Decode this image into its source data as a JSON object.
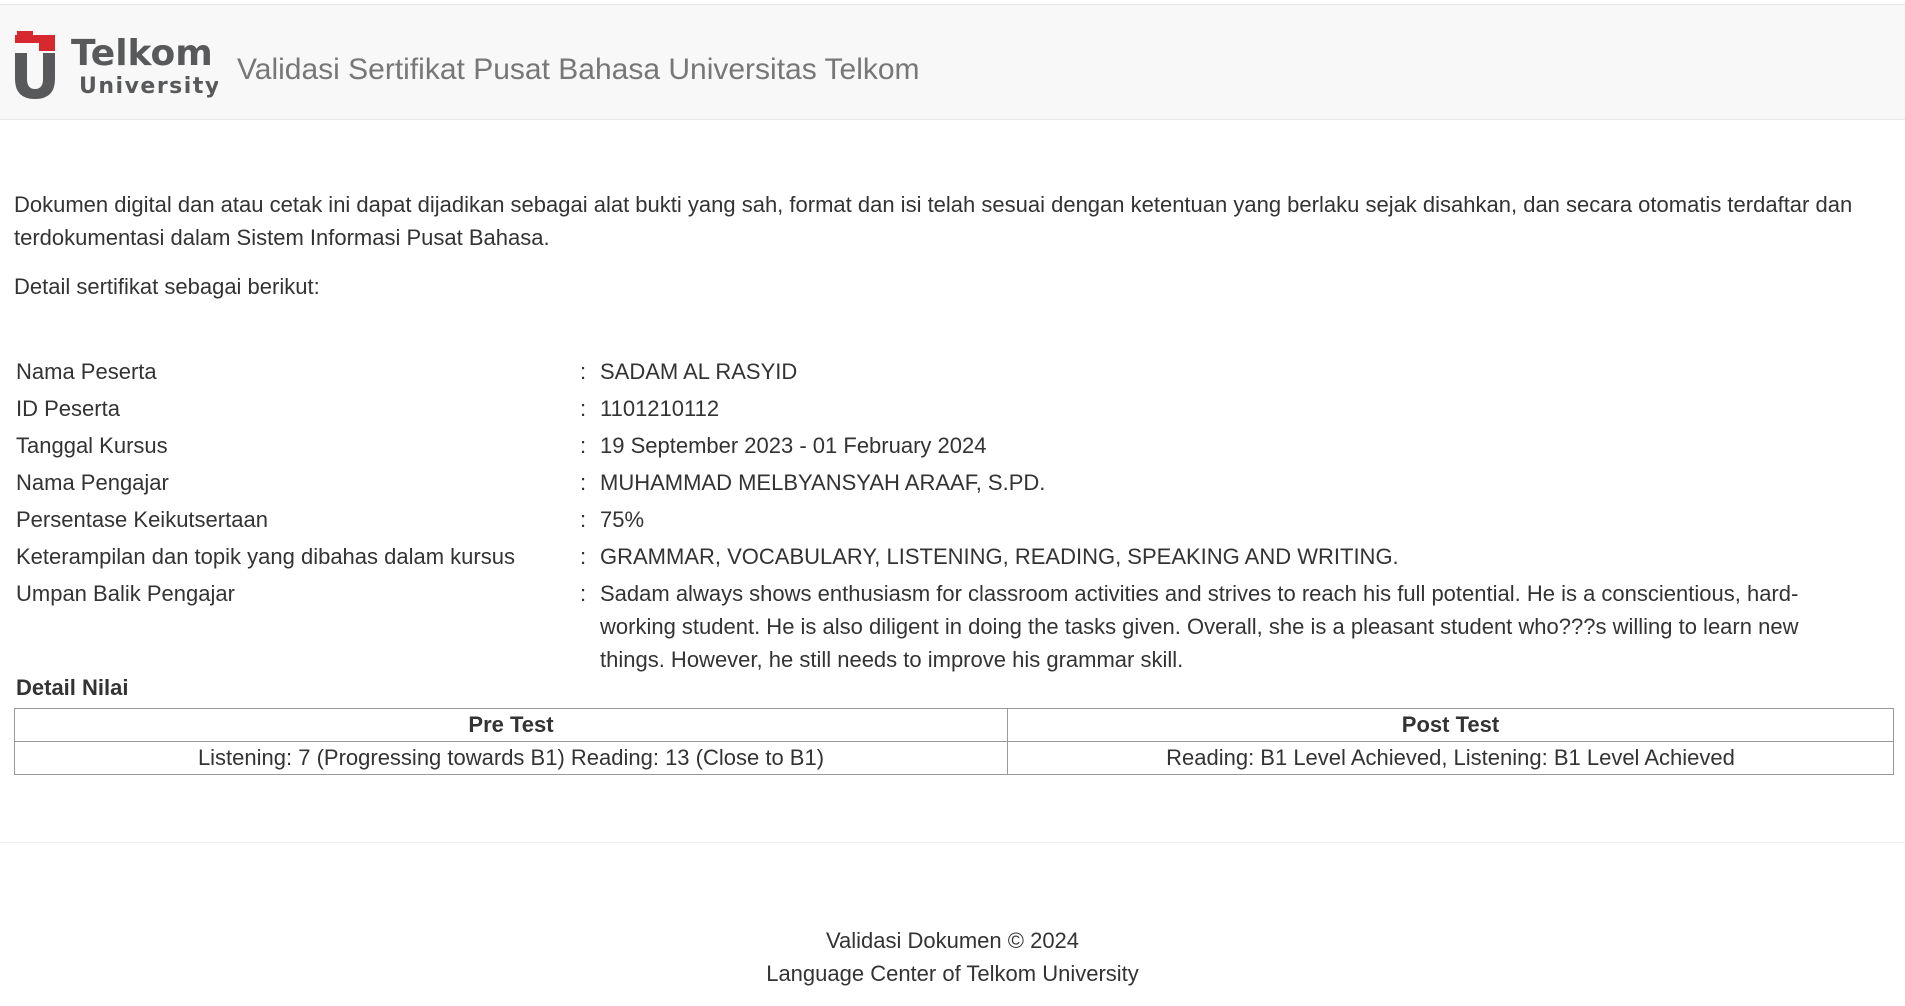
{
  "header": {
    "logo_word": "Telkom",
    "logo_sub": "University",
    "title": "Validasi Sertifikat Pusat Bahasa Universitas Telkom"
  },
  "intro": {
    "paragraph": "Dokumen digital dan atau cetak ini dapat dijadikan sebagai alat bukti yang sah, format dan isi telah sesuai dengan ketentuan yang berlaku sejak disahkan, dan secara otomatis terdaftar dan terdokumentasi dalam Sistem Informasi Pusat Bahasa.",
    "detail_label": "Detail sertifikat sebagai berikut:"
  },
  "details": [
    {
      "label": "Nama Peserta",
      "colon": ":",
      "value": "SADAM AL RASYID"
    },
    {
      "label": "ID Peserta",
      "colon": ":",
      "value": "1101210112"
    },
    {
      "label": "Tanggal Kursus",
      "colon": ":",
      "value": "19 September 2023 - 01 February 2024"
    },
    {
      "label": "Nama Pengajar",
      "colon": ":",
      "value": "MUHAMMAD MELBYANSYAH ARAAF, S.PD."
    },
    {
      "label": "Persentase Keikutsertaan",
      "colon": ":",
      "value": "75%"
    },
    {
      "label": "Keterampilan dan topik yang dibahas dalam kursus",
      "colon": ":",
      "value": "GRAMMAR, VOCABULARY, LISTENING, READING, SPEAKING AND WRITING."
    },
    {
      "label": "Umpan Balik Pengajar",
      "colon": ":",
      "value": "Sadam always shows enthusiasm for classroom activities and strives to reach his full potential. He is a conscientious, hard-working student. He is also diligent in doing the tasks given. Overall, she is a pleasant student who???s willing to learn new things. However, he still needs to improve his grammar skill."
    }
  ],
  "scores": {
    "title": "Detail Nilai",
    "pre_header": "Pre Test",
    "post_header": "Post Test",
    "pre_value": "Listening: 7 (Progressing towards B1) Reading: 13 (Close to B1)",
    "post_value": "Reading: B1 Level Achieved, Listening: B1 Level Achieved"
  },
  "footer": {
    "line1": "Validasi Dokumen © 2024",
    "line2": "Language Center of Telkom University"
  },
  "colors": {
    "header_bg": "#f8f8f8",
    "logo_red": "#d7282f",
    "logo_gray": "#58595b"
  }
}
